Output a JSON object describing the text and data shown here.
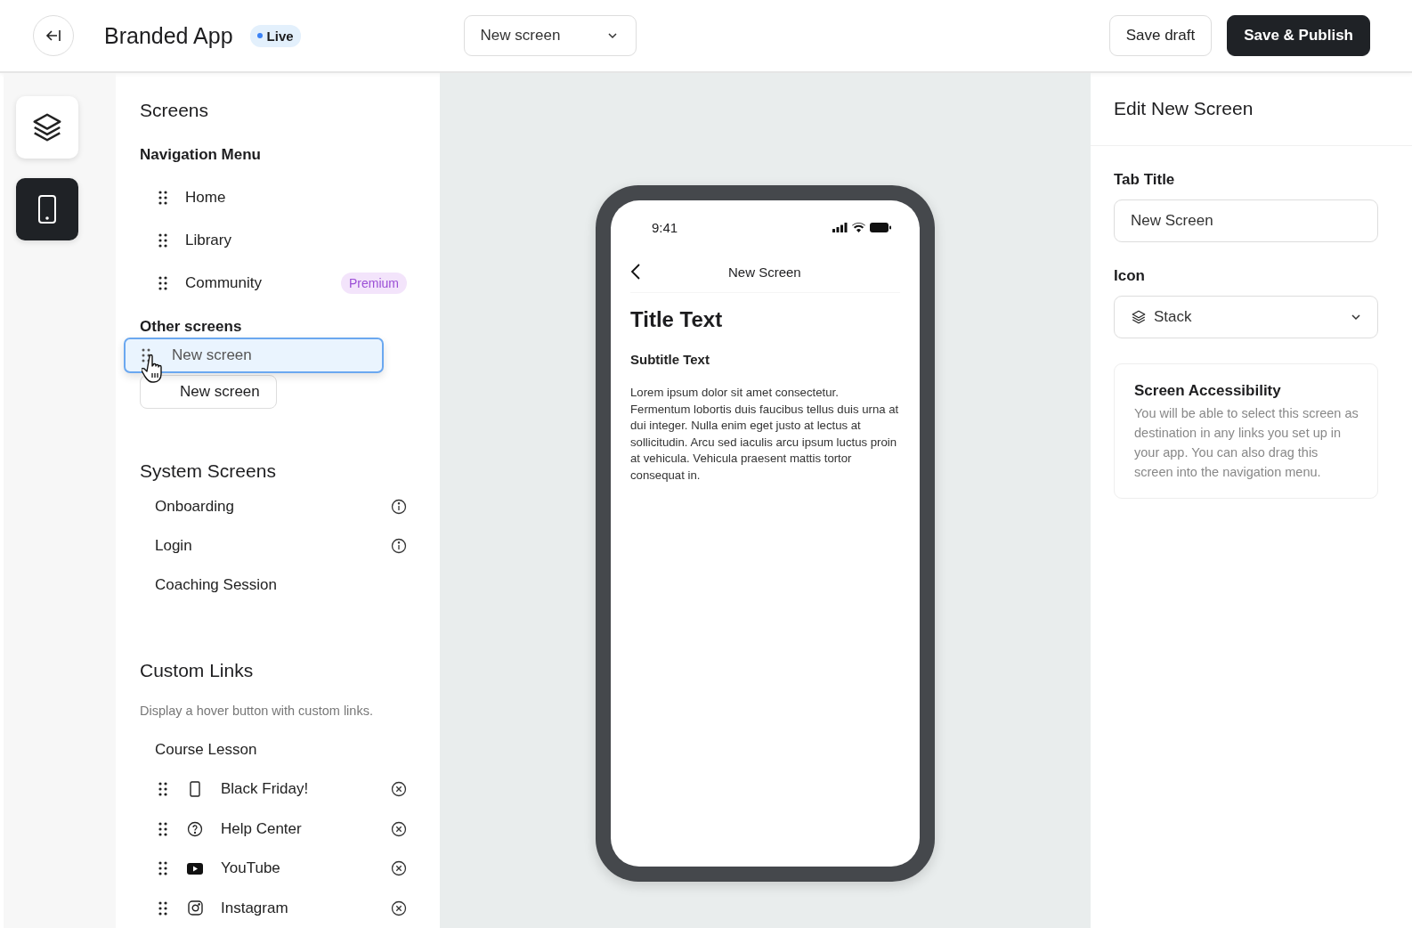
{
  "header": {
    "app_name": "Branded App",
    "status_badge": {
      "label": "Live",
      "color": "#3b82f6"
    },
    "screen_select": {
      "value": "New screen"
    },
    "buttons": [
      {
        "label": "Save draft",
        "kind": "secondary"
      },
      {
        "label": "Save & Publish",
        "kind": "primary"
      }
    ]
  },
  "rail": [
    {
      "selected": false
    },
    {
      "selected": true
    }
  ],
  "sidebar": {
    "title": "Screens",
    "navigation_menu": {
      "heading": "Navigation Menu",
      "items": [
        {
          "label": "Home"
        },
        {
          "label": "Library"
        },
        {
          "label": "Community",
          "badge": "Premium"
        }
      ]
    },
    "other_screens": {
      "heading": "Other screens",
      "items": [
        {
          "label": "New screen"
        }
      ],
      "drag_ghost": {
        "label": "New screen"
      }
    },
    "system_screens": {
      "heading": "System Screens",
      "items": [
        {
          "label": "Onboarding",
          "info": true
        },
        {
          "label": "Login",
          "info": true
        },
        {
          "label": "Coaching Session",
          "info": false
        }
      ]
    },
    "custom_links": {
      "heading": "Custom Links",
      "description": "Display a hover button with custom links.",
      "group": "Course Lesson",
      "links": [
        {
          "label": "Black Friday!",
          "kind": "phone"
        },
        {
          "label": "Help Center",
          "kind": "help"
        },
        {
          "label": "YouTube",
          "kind": "video"
        },
        {
          "label": "Instagram",
          "kind": "camera"
        }
      ]
    }
  },
  "preview": {
    "time": "9:41",
    "nav_title": "New Screen",
    "title": "Title Text",
    "subtitle": "Subtitle Text",
    "body": "Lorem ipsum dolor sit amet consectetur. Fermentum lobortis duis faucibus tellus duis urna at dui integer. Nulla enim eget justo at lectus at sollicitudin. Arcu sed iaculis arcu ipsum luctus proin at vehicula. Vehicula praesent mattis tortor consequat in."
  },
  "editor": {
    "title": "Edit New Screen",
    "tab_title": {
      "label": "Tab Title",
      "value": "New Screen"
    },
    "icon": {
      "label": "Icon",
      "value": "Stack"
    },
    "accessibility": {
      "title": "Screen Accessibility",
      "text": "You will be able to select this screen as destination in any links you set up in your app. You can also drag this screen into the navigation menu."
    }
  }
}
